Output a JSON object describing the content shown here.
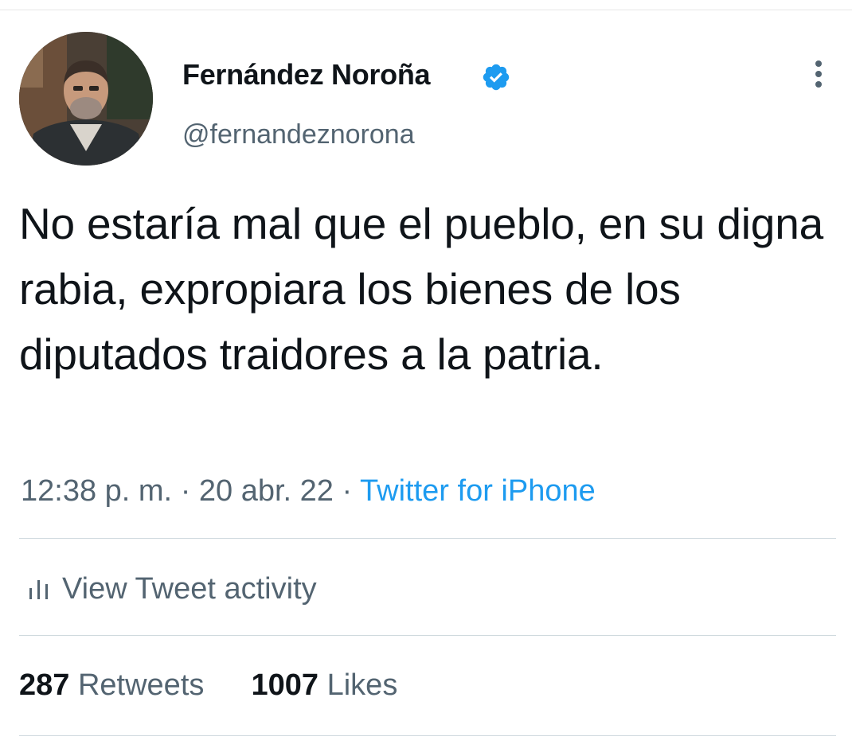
{
  "author": {
    "name": "Fernández Noroña",
    "handle": "@fernandeznorona",
    "verified": true
  },
  "tweet": {
    "text": "No estaría mal que el pueblo, en su digna rabia, expropiara los bienes de los diputados traidores a la patria."
  },
  "meta": {
    "time": "12:38 p. m.",
    "separator": "·",
    "date": "20 abr. 22",
    "source": "Twitter for iPhone"
  },
  "activity": {
    "label": "View Tweet activity"
  },
  "stats": {
    "retweets_count": "287",
    "retweets_label": "Retweets",
    "likes_count": "1007",
    "likes_label": "Likes"
  },
  "icons": {
    "verified": "verified-badge-icon",
    "more": "more-vertical-icon",
    "activity": "bar-chart-icon"
  },
  "colors": {
    "link": "#1d9bf0",
    "secondary_text": "#536471",
    "primary_text": "#0f1419",
    "divider": "#cfd9de"
  }
}
